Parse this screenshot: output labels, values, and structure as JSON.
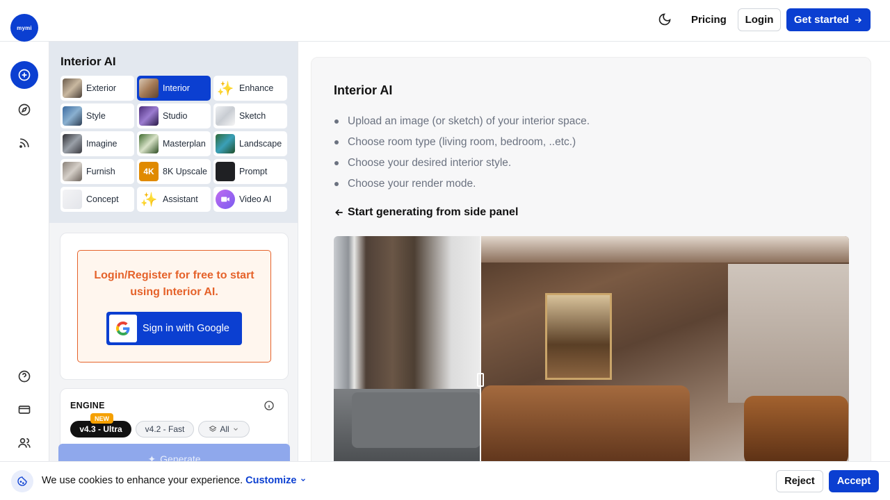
{
  "brand": {
    "logo_text": "mymi"
  },
  "header": {
    "pricing_label": "Pricing",
    "login_label": "Login",
    "get_started_label": "Get started"
  },
  "rail": {
    "items": [
      "create-icon",
      "explore-icon",
      "feed-icon"
    ],
    "bottom_items": [
      "help-icon",
      "billing-icon",
      "users-icon"
    ]
  },
  "sidepanel": {
    "title": "Interior AI",
    "tools": [
      {
        "label": "Exterior",
        "icon": "exterior-thumb"
      },
      {
        "label": "Interior",
        "icon": "interior-thumb",
        "selected": true
      },
      {
        "label": "Enhance",
        "icon": "sparkle-icon"
      },
      {
        "label": "Style",
        "icon": "style-thumb"
      },
      {
        "label": "Studio",
        "icon": "studio-thumb"
      },
      {
        "label": "Sketch",
        "icon": "sketch-thumb"
      },
      {
        "label": "Imagine",
        "icon": "imagine-thumb"
      },
      {
        "label": "Masterplan",
        "icon": "masterplan-thumb"
      },
      {
        "label": "Landscape",
        "icon": "landscape-thumb"
      },
      {
        "label": "Furnish",
        "icon": "furnish-thumb"
      },
      {
        "label": "8K Upscale",
        "icon": "upscale-thumb"
      },
      {
        "label": "Prompt",
        "icon": "prompt-thumb"
      },
      {
        "label": "Concept",
        "icon": "concept-thumb"
      },
      {
        "label": "Assistant",
        "icon": "sparkle-icon"
      },
      {
        "label": "Video AI",
        "icon": "video-thumb"
      }
    ],
    "login_message": "Login/Register for free to start using Interior AI.",
    "google_label": "Sign in with Google",
    "engine": {
      "label": "ENGINE",
      "new_badge": "NEW",
      "options": [
        "v4.3 - Ultra",
        "v4.2 - Fast",
        "All"
      ]
    },
    "generate_label": "Generate"
  },
  "main": {
    "title": "Interior AI",
    "steps": [
      "Upload an image (or sketch) of your interior space.",
      "Choose room type (living room, bedroom, ..etc.)",
      "Choose your desired interior style.",
      "Choose your render mode."
    ],
    "start_hint": "Start generating from side panel"
  },
  "cookie": {
    "text": "We use cookies to enhance your experience.",
    "customize_label": "Customize",
    "reject_label": "Reject",
    "accept_label": "Accept"
  },
  "colors": {
    "accent": "#0b3fd1",
    "login_orange": "#e5622a",
    "new_badge": "#f5a000"
  }
}
